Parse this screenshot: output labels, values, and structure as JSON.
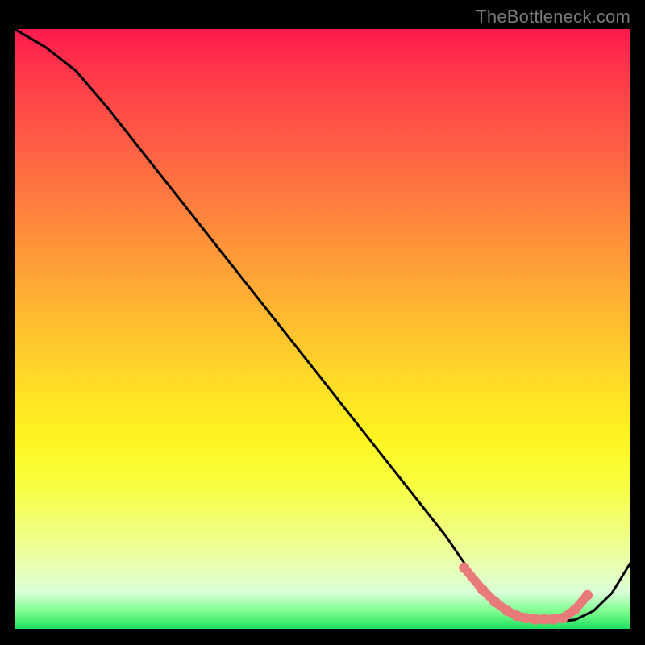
{
  "attribution": "TheBottleneck.com",
  "chart_data": {
    "type": "line",
    "title": "",
    "xlabel": "",
    "ylabel": "",
    "xlim": [
      0,
      100
    ],
    "ylim": [
      0,
      100
    ],
    "series": [
      {
        "name": "curve",
        "x": [
          0,
          5,
          10,
          15,
          20,
          25,
          30,
          35,
          40,
          45,
          50,
          55,
          60,
          65,
          70,
          73,
          76,
          79,
          82,
          85,
          88,
          91,
          94,
          97,
          100
        ],
        "y": [
          100,
          97,
          93,
          87,
          80.5,
          74,
          67.5,
          61,
          54.5,
          48,
          41.5,
          35,
          28.5,
          22,
          15.5,
          11,
          7,
          4,
          2,
          1.2,
          1.2,
          1.5,
          3,
          6,
          11
        ]
      },
      {
        "name": "valley-markers",
        "x": [
          73,
          76,
          78,
          80,
          81.5,
          83,
          84.5,
          86,
          87.5,
          89,
          91,
          93
        ],
        "y": [
          10.2,
          6.5,
          4.5,
          3.0,
          2.2,
          1.8,
          1.6,
          1.6,
          1.6,
          1.8,
          3.2,
          5.6
        ]
      }
    ],
    "marker_color": "#e87a7a",
    "line_color": "#000000"
  }
}
